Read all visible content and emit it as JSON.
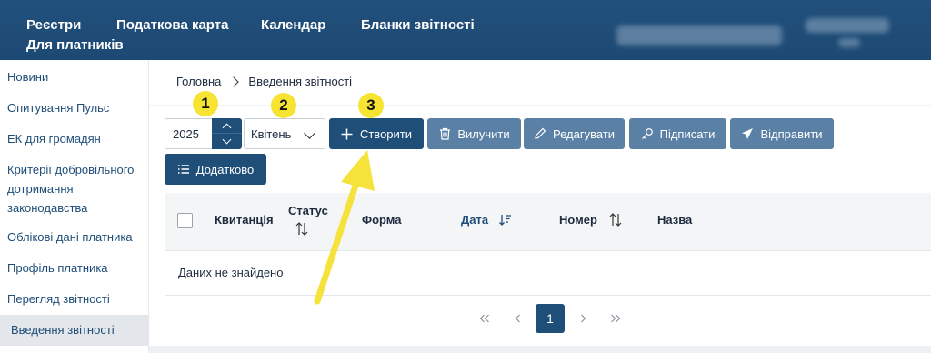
{
  "nav": {
    "items": [
      "Реєстри",
      "Податкова карта",
      "Календар",
      "Бланки звітності"
    ],
    "second_line": "Для платників"
  },
  "sidebar": {
    "items": [
      {
        "label": "Новини"
      },
      {
        "label": "Опитування Пульс"
      },
      {
        "label": "ЕК для громадян"
      },
      {
        "label": "Критерії добровільного дотримання законодавства"
      },
      {
        "label": "Облікові дані платника"
      },
      {
        "label": "Профіль платника"
      },
      {
        "label": "Перегляд звітності"
      },
      {
        "label": "Введення звітності",
        "active": true
      }
    ]
  },
  "breadcrumb": {
    "home": "Головна",
    "current": "Введення звітності"
  },
  "steps": [
    "1",
    "2",
    "3"
  ],
  "toolbar": {
    "year_value": "2025",
    "month_value": "Квітень",
    "create_label": "Створити",
    "delete_label": "Вилучити",
    "edit_label": "Редагувати",
    "sign_label": "Підписати",
    "send_label": "Відправити",
    "more_label": "Додатково"
  },
  "table": {
    "columns": [
      "Квитанція",
      "Статус",
      "Форма",
      "Дата",
      "Номер",
      "Назва"
    ],
    "sorted_column": "Дата",
    "empty_message": "Даних не знайдено"
  },
  "pagination": {
    "current_page": "1"
  },
  "colors": {
    "primary": "#1f4e79",
    "secondary": "#5b80a6",
    "badge": "#f6e332",
    "arrow": "#f5e23a"
  }
}
